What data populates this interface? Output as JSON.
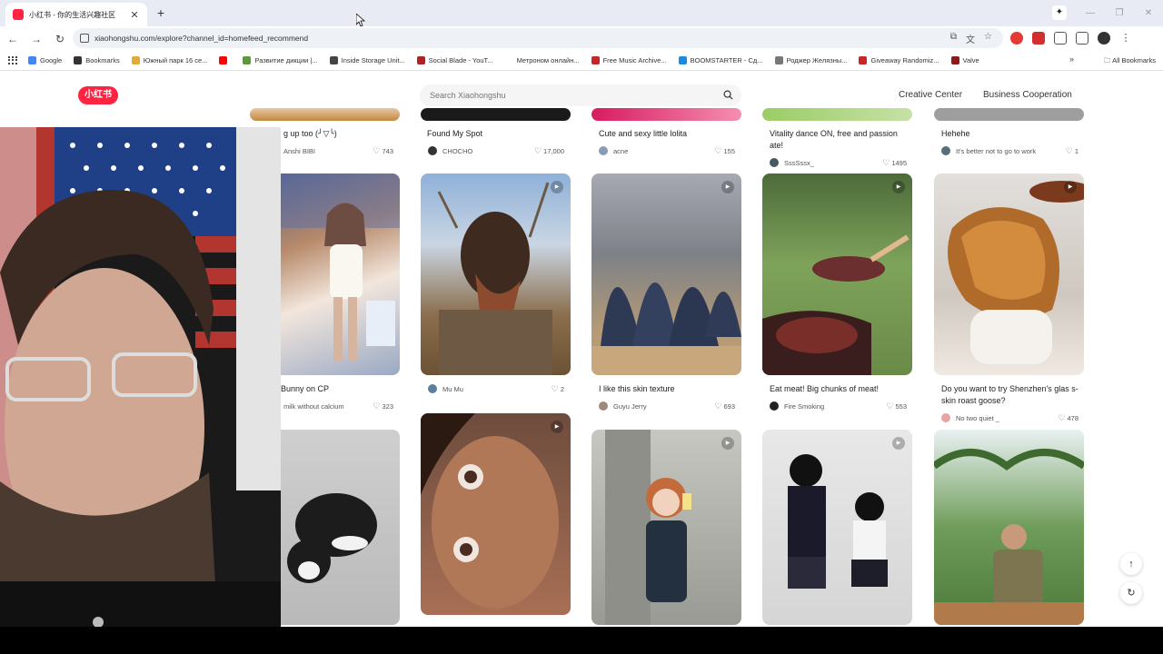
{
  "browser": {
    "tab_title": "小红书 - 你的生活兴趣社区",
    "new_tab_label": "+",
    "url": "xiaohongshu.com/explore?channel_id=homefeed_recommend",
    "bookmarks": [
      {
        "label": "Google",
        "color": "#4285f4"
      },
      {
        "label": "Bookmarks",
        "color": "#333333"
      },
      {
        "label": "Южный парк 16 се...",
        "color": "#e2a93b"
      },
      {
        "label": "",
        "color": "#ff0000"
      },
      {
        "label": "Развитие дикции |...",
        "color": "#5a9a3a"
      },
      {
        "label": "Inside Storage Unit...",
        "color": "#444444"
      },
      {
        "label": "Social Blade - YouT...",
        "color": "#b22222"
      },
      {
        "label": "Метроном онлайн...",
        "color": "#ffffff"
      },
      {
        "label": "Free Music Archive...",
        "color": "#c62828"
      },
      {
        "label": "BOOMSTARTER - Сд...",
        "color": "#1e88e5"
      },
      {
        "label": "Роджер Желязны...",
        "color": "#777777"
      },
      {
        "label": "Giveaway Randomiz...",
        "color": "#c62828"
      },
      {
        "label": "Valve",
        "color": "#8b1a1a"
      }
    ],
    "bookmarks_more": "»",
    "all_bookmarks": "All Bookmarks"
  },
  "site": {
    "logo_text": "小红书",
    "search_placeholder": "Search Xiaohongshu",
    "nav": {
      "creative_center": "Creative Center",
      "business_cooperation": "Business Cooperation"
    }
  },
  "feed": {
    "top_row": [
      {
        "title": "g up too (╯▽╰)",
        "author": "Anshi BIBI",
        "likes": "743"
      },
      {
        "title": "Found My Spot",
        "author": "CHOCHO",
        "likes": "17,000"
      },
      {
        "title": "Cute and sexy little lolita",
        "author": "acne",
        "likes": "155"
      },
      {
        "title": "Vitality dance ON, free and passion ate!",
        "author": "SssSssx_",
        "likes": "1495"
      },
      {
        "title": "Hehehe",
        "author": "It's better not to go to work",
        "likes": "1"
      }
    ],
    "middle_row": [
      {
        "title": "Bunny on CP",
        "author": "milk without calcium",
        "likes": "323"
      },
      {
        "title": "",
        "author": "Mu Mu",
        "likes": "2"
      },
      {
        "title": "I like this skin texture",
        "author": "Guyu Jerry",
        "likes": "693"
      },
      {
        "title": "Eat meat! Big chunks of meat!",
        "author": "Fire Smoking",
        "likes": "553"
      },
      {
        "title": "Do you want to try Shenzhen's glas s-skin roast goose?",
        "author": "No two quiet _",
        "likes": "478"
      }
    ]
  },
  "colors": {
    "brand": "#ff2442",
    "page_bg": "#ffffff",
    "chrome_bg": "#e8ebf4"
  }
}
